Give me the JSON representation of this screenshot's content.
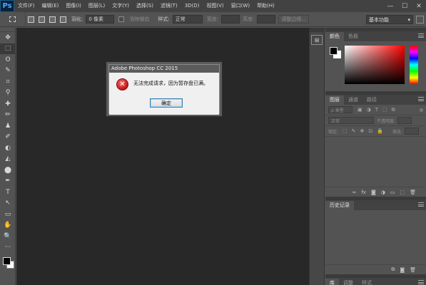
{
  "app": {
    "logo": "Ps"
  },
  "menu": {
    "items": [
      "文件(F)",
      "编辑(E)",
      "图像(I)",
      "图层(L)",
      "文字(Y)",
      "选择(S)",
      "滤镜(T)",
      "3D(D)",
      "视图(V)",
      "窗口(W)",
      "帮助(H)"
    ]
  },
  "window_controls": {
    "minimize": "—",
    "maximize": "☐",
    "close": "✕"
  },
  "options": {
    "feather_label": "羽化:",
    "feather_value": "0 像素",
    "antialias_label": "消除锯齿",
    "style_label": "样式:",
    "style_value": "正常",
    "width_label": "宽度:",
    "height_label": "高度:",
    "refine_edge": "调整边缘...",
    "workspace": "基本功能"
  },
  "tools": [
    "✥",
    "⬚",
    "ʘ",
    "✎",
    "⌗",
    "⚲",
    "✚",
    "✏",
    "♟",
    "✐",
    "◐",
    "◭",
    "⬤",
    "✒",
    "T",
    "↖",
    "▭",
    "✋",
    "🔍",
    "···"
  ],
  "dialog": {
    "title": "Adobe Photoshop CC 2015",
    "message": "无法完成请求，因为暂存盘已满。",
    "ok": "确定",
    "icon_glyph": "✕"
  },
  "panels": {
    "color_tabs": [
      "颜色",
      "色板"
    ],
    "layers_tabs": [
      "图层",
      "通道",
      "路径"
    ],
    "layers_filter": "ρ 类型",
    "blend_mode": "正常",
    "opacity_label": "不透明度:",
    "lock_label": "锁定:",
    "fill_label": "填充:",
    "layers_footer_icons": [
      "∞",
      "fx",
      "◙",
      "◑",
      "▭",
      "⬚",
      "🗑"
    ],
    "history_tab": "历史记录",
    "history_footer_icons": [
      "⧉",
      "◙",
      "🗑"
    ],
    "lib_tabs": [
      "库",
      "调整",
      "样式"
    ]
  },
  "colors": {
    "accent": "#4aa8ff",
    "error": "#c31616"
  }
}
